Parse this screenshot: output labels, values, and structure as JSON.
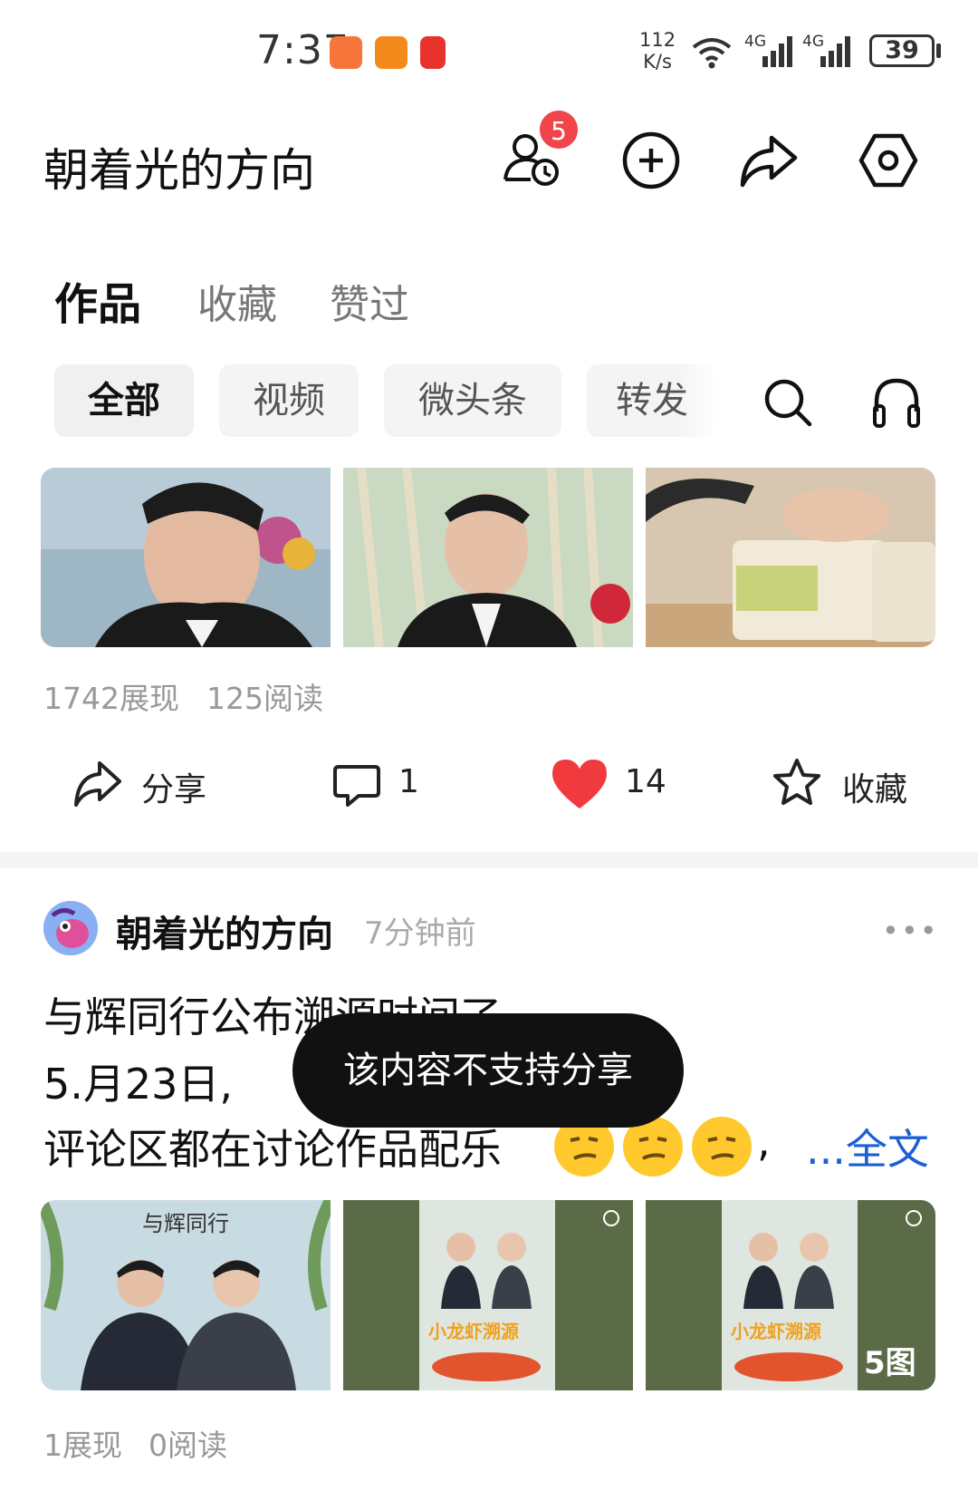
{
  "status_bar": {
    "time": "7:37",
    "net_speed_value": "112",
    "net_speed_unit": "K/s",
    "signal_1_label": "4G",
    "signal_2_label": "4G",
    "battery": "39"
  },
  "header": {
    "title": "朝着光的方向",
    "notification_count": "5"
  },
  "tabs": [
    {
      "label": "作品"
    },
    {
      "label": "收藏"
    },
    {
      "label": "赞过"
    }
  ],
  "filters": [
    {
      "label": "全部"
    },
    {
      "label": "视频"
    },
    {
      "label": "微头条"
    },
    {
      "label": "转发"
    }
  ],
  "post1": {
    "views": "1742展现",
    "reads": "125阅读",
    "share_label": "分享",
    "comment_count": "1",
    "like_count": "14",
    "favorite_label": "收藏"
  },
  "post2": {
    "author": "朝着光的方向",
    "time": "7分钟前",
    "line1": "与辉同行公布溯源时间了,",
    "line2": "5.月23日,",
    "line3": "评论区都在讨论作品配乐",
    "line3_suffix": ",",
    "read_more": "...全文",
    "image_count": "5图",
    "views": "1展现",
    "reads": "0阅读",
    "poster_caption": "小龙虾溯源"
  },
  "toast": "该内容不支持分享",
  "colors": {
    "badge": "#f0454a",
    "like_heart": "#f03a3e",
    "link": "#1a5fd6"
  }
}
